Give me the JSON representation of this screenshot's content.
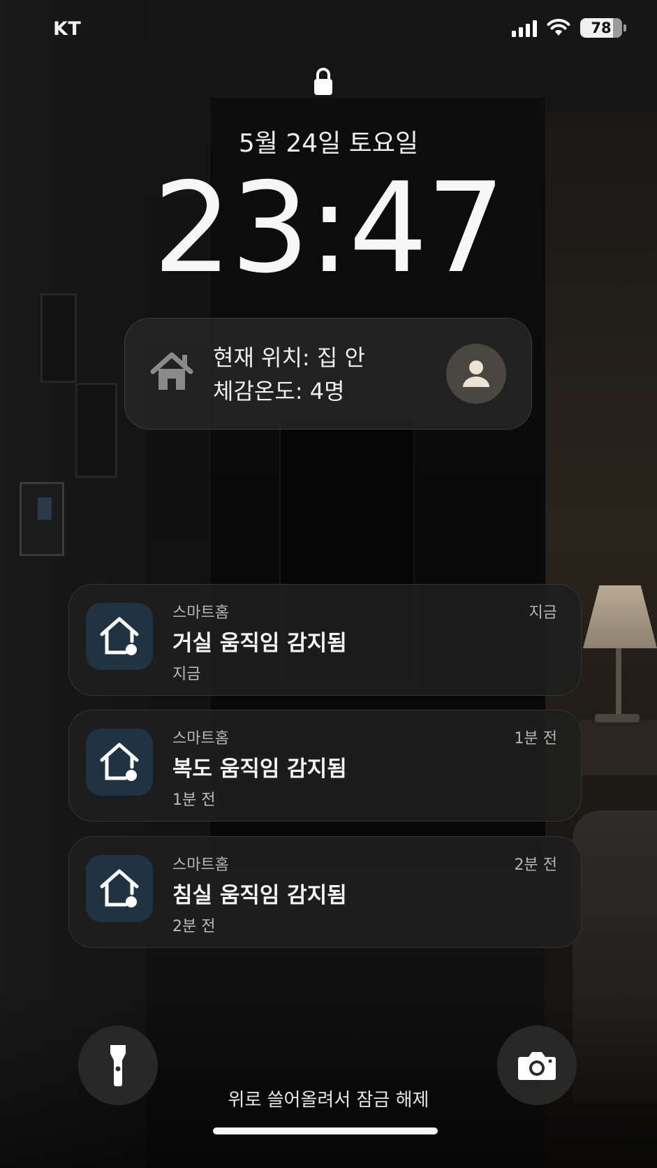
{
  "status_bar": {
    "carrier": "KT",
    "battery": "78",
    "battery_level": 0.78,
    "icons": [
      "signal-icon",
      "wifi-icon",
      "battery-icon"
    ]
  },
  "lock": {
    "icon": "lock-icon"
  },
  "date": "5월 24일 토요일",
  "time": "23:47",
  "widget": {
    "icon": "home-icon",
    "line1": "현재 위치: 집 안",
    "line2": "체감온도: 4명",
    "avatar_icon": "person-icon"
  },
  "notifications": [
    {
      "app": "스마트홈",
      "title": "거실 움직임 감지됨",
      "sub": "지금",
      "time": "지금",
      "icon": "smart-home-icon"
    },
    {
      "app": "스마트홈",
      "title": "복도 움직임 감지됨",
      "sub": "1분 전",
      "time": "1분 전",
      "icon": "smart-home-icon"
    },
    {
      "app": "스마트홈",
      "title": "침실 움직임 감지됨",
      "sub": "2분 전",
      "time": "2분 전",
      "icon": "smart-home-icon"
    }
  ],
  "bottom": {
    "flashlight_icon": "flashlight-icon",
    "camera_icon": "camera-icon",
    "unlock_hint": "위로 쓸어올려서 잠금 해제"
  },
  "colors": {
    "notification_icon_bg": "#1f3342",
    "card_bg": "#1e1e1e",
    "text": "#f5f5f5"
  }
}
